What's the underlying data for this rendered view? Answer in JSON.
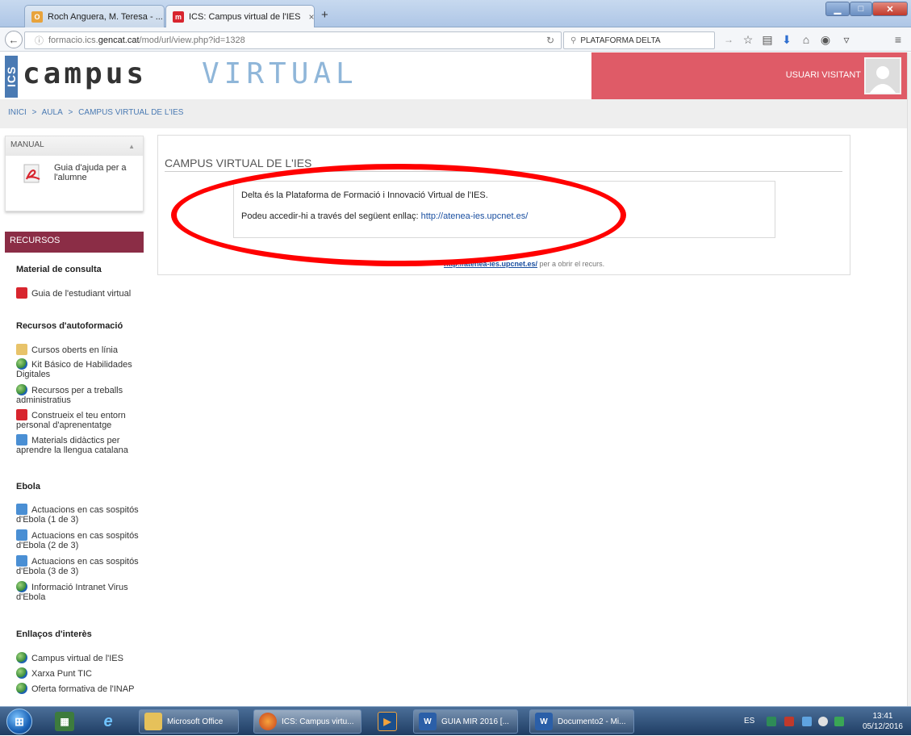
{
  "browser": {
    "tabs": [
      {
        "label": "Roch Anguera, M. Teresa - ...",
        "favicon": "O",
        "active": false
      },
      {
        "label": "ICS: Campus virtual de l'IES",
        "favicon": "m",
        "active": true
      }
    ],
    "new_tab": "+",
    "url_prefix": "formacio.ics.",
    "url_host": "gencat.cat",
    "url_path": "/mod/url/view.php?id=1328",
    "search_value": "PLATAFORMA DELTA"
  },
  "site": {
    "logo_ics": "ICS",
    "logo_campus": "campus",
    "logo_virtual": "VIRTUAL",
    "user_label": "USUARI VISITANT"
  },
  "breadcrumb": [
    "INICI",
    ">",
    "AULA",
    ">",
    "CAMPUS VIRTUAL DE L'IES"
  ],
  "sidebar": {
    "manual_title": "MANUAL",
    "manual_item": "Guia d'ajuda per a l'alumne",
    "recursos_title": "RECURSOS",
    "sections": [
      {
        "title": "Material de consulta",
        "items": [
          {
            "label": "Guia de l'estudiant virtual",
            "icon": "pdf"
          }
        ]
      },
      {
        "title": "Recursos d'autoformació",
        "items": [
          {
            "label": "Cursos oberts en línia",
            "icon": "folder"
          },
          {
            "label": "Kit Básico de Habilidades Digitales",
            "icon": "globe"
          },
          {
            "label": "Recursos per a treballs administratius",
            "icon": "globe"
          },
          {
            "label": "Construeix el teu entorn personal d'aprenentatge",
            "icon": "pdf"
          },
          {
            "label": "Materials didàctics per aprendre la llengua catalana",
            "icon": "doc"
          }
        ]
      },
      {
        "title": "Ebola",
        "items": [
          {
            "label": "Actuacions en cas sospitós d'Ebola (1 de 3)",
            "icon": "doc"
          },
          {
            "label": "Actuacions en cas sospitós d'Ebola (2 de 3)",
            "icon": "doc"
          },
          {
            "label": "Actuacions en cas sospitós d'Ebola (3 de 3)",
            "icon": "doc"
          },
          {
            "label": "Informació Intranet Virus d'Ebola",
            "icon": "globe"
          }
        ]
      },
      {
        "title": "Enllaços d'interès",
        "items": [
          {
            "label": "Campus virtual de l'IES",
            "icon": "globe"
          },
          {
            "label": "Xarxa Punt TIC",
            "icon": "globe"
          },
          {
            "label": "Oferta formativa de l'INAP",
            "icon": "globe"
          }
        ]
      }
    ]
  },
  "main": {
    "title": "CAMPUS VIRTUAL DE L'IES",
    "intro_line1": "Delta és la Plataforma de Formació i Innovació Virtual de l'IES.",
    "intro_line2_prefix": "Podeu accedir-hi a través del següent enllaç:",
    "intro_link": "http://atenea-ies.upcnet.es/",
    "click_link": "http://atenea-ies.upcnet.es/",
    "click_suffix": "per a obrir el recurs."
  },
  "taskbar": {
    "tasks": [
      "Microsoft Office",
      "ICS: Campus virtu...",
      "GUIA MIR 2016 [...",
      "Documento2 - Mi..."
    ],
    "language": "ES",
    "time": "13:41",
    "date": "05/12/2016"
  },
  "colors": {
    "user_box": "#df5b67",
    "recursos_header": "#8b2d46",
    "highlight_ring": "#ff0000",
    "link": "#1a4fa0"
  }
}
